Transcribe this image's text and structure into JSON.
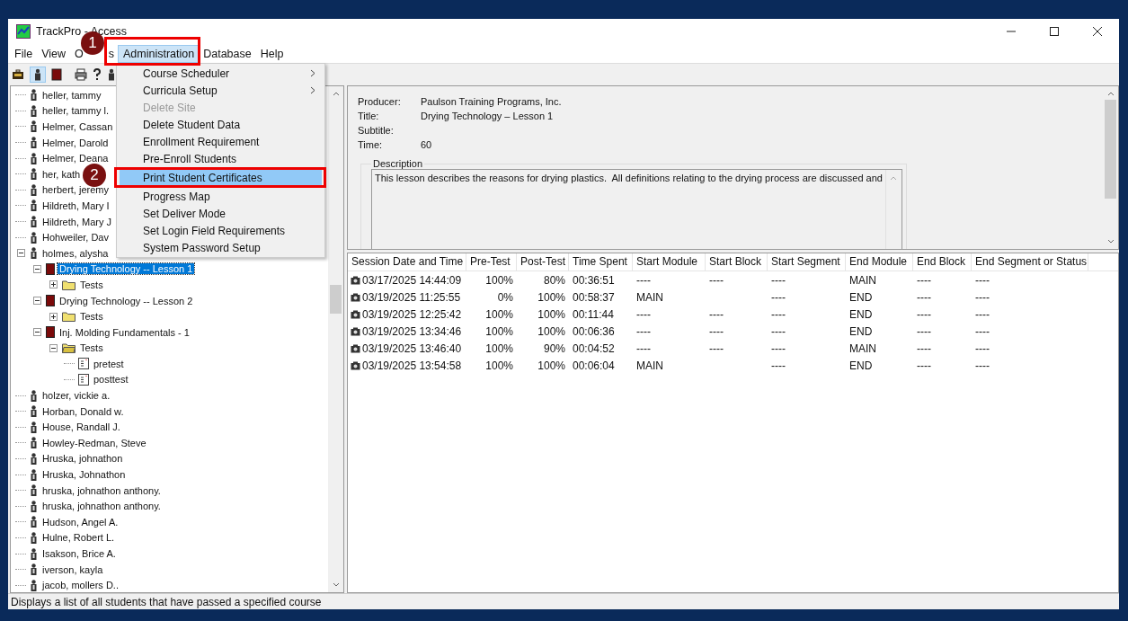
{
  "window": {
    "title": "TrackPro - Access"
  },
  "menu_bar": [
    {
      "label": "File",
      "selected": false
    },
    {
      "label": "View",
      "selected": false
    },
    {
      "label": "O",
      "tail": "s",
      "selected": false
    },
    {
      "label": "Administration",
      "selected": true
    },
    {
      "label": "Database",
      "selected": false
    },
    {
      "label": "Help",
      "selected": false
    }
  ],
  "admin_menu": [
    {
      "label": "Course Scheduler",
      "submenu": true,
      "disabled": false,
      "selected": false
    },
    {
      "label": "Curricula Setup",
      "submenu": true,
      "disabled": false,
      "selected": false
    },
    {
      "label": "Delete Site",
      "submenu": false,
      "disabled": true,
      "selected": false
    },
    {
      "label": "Delete Student Data",
      "submenu": false,
      "disabled": false,
      "selected": false
    },
    {
      "label": "Enrollment Requirement",
      "submenu": false,
      "disabled": false,
      "selected": false
    },
    {
      "label": "Pre-Enroll Students",
      "submenu": false,
      "disabled": false,
      "selected": false
    },
    {
      "label": "Print Student Certificates",
      "submenu": false,
      "disabled": false,
      "selected": true
    },
    {
      "label": "Progress Map",
      "submenu": false,
      "disabled": false,
      "selected": false
    },
    {
      "label": "Set Deliver Mode",
      "submenu": false,
      "disabled": false,
      "selected": false
    },
    {
      "label": "Set Login Field Requirements",
      "submenu": false,
      "disabled": false,
      "selected": false
    },
    {
      "label": "System Password Setup",
      "submenu": false,
      "disabled": false,
      "selected": false
    }
  ],
  "callouts": [
    {
      "number": "1"
    },
    {
      "number": "2"
    }
  ],
  "tree": [
    {
      "label": "heller, tammy",
      "kind": "student",
      "selected": false
    },
    {
      "label": "heller, tammy l.",
      "kind": "student",
      "selected": false
    },
    {
      "label": "Helmer, Cassan",
      "kind": "student",
      "selected": false
    },
    {
      "label": "Helmer, Darold",
      "kind": "student",
      "selected": false
    },
    {
      "label": "Helmer, Deana",
      "kind": "student",
      "selected": false
    },
    {
      "label": "her, kath",
      "kind": "student",
      "selected": false
    },
    {
      "label": "herbert, jeremy",
      "kind": "student",
      "selected": false
    },
    {
      "label": "Hildreth, Mary I",
      "kind": "student",
      "selected": false
    },
    {
      "label": "Hildreth, Mary J",
      "kind": "student",
      "selected": false
    },
    {
      "label": "Hohweiler, Dav",
      "kind": "student",
      "selected": false
    },
    {
      "label": "holmes, alysha",
      "kind": "student",
      "selected": false,
      "expanded": true,
      "children": [
        {
          "label": "Drying Technology -- Lesson 1",
          "kind": "course",
          "selected": true,
          "expanded": true,
          "children": [
            {
              "label": "Tests",
              "kind": "folder",
              "selected": false,
              "expanded": false
            }
          ]
        },
        {
          "label": "Drying Technology -- Lesson 2",
          "kind": "course",
          "selected": false,
          "expanded": true,
          "children": [
            {
              "label": "Tests",
              "kind": "folder",
              "selected": false,
              "expanded": false
            }
          ]
        },
        {
          "label": "Inj. Molding Fundamentals - 1",
          "kind": "course",
          "selected": false,
          "expanded": true,
          "children": [
            {
              "label": "Tests",
              "kind": "folder",
              "selected": false,
              "expanded": true,
              "children": [
                {
                  "label": "pretest",
                  "kind": "test",
                  "selected": false
                },
                {
                  "label": "posttest",
                  "kind": "test",
                  "selected": false
                }
              ]
            }
          ]
        }
      ]
    },
    {
      "label": "holzer, vickie a.",
      "kind": "student",
      "selected": false
    },
    {
      "label": "Horban, Donald w.",
      "kind": "student",
      "selected": false
    },
    {
      "label": "House, Randall J.",
      "kind": "student",
      "selected": false
    },
    {
      "label": "Howley-Redman, Steve",
      "kind": "student",
      "selected": false
    },
    {
      "label": "Hruska, johnathon",
      "kind": "student",
      "selected": false
    },
    {
      "label": "Hruska, Johnathon",
      "kind": "student",
      "selected": false
    },
    {
      "label": "hruska, johnathon anthony.",
      "kind": "student",
      "selected": false
    },
    {
      "label": "hruska, johnathon anthony.",
      "kind": "student",
      "selected": false
    },
    {
      "label": "Hudson, Angel A.",
      "kind": "student",
      "selected": false
    },
    {
      "label": "Hulne, Robert L.",
      "kind": "student",
      "selected": false
    },
    {
      "label": "Isakson, Brice A.",
      "kind": "student",
      "selected": false
    },
    {
      "label": "iverson, kayla",
      "kind": "student",
      "selected": false
    },
    {
      "label": "jacob, mollers D..",
      "kind": "student",
      "selected": false
    }
  ],
  "details": {
    "fields": [
      {
        "label": "Producer:",
        "value": "Paulson Training Programs, Inc."
      },
      {
        "label": "Title:",
        "value": "Drying Technology – Lesson 1"
      },
      {
        "label": "Subtitle:"
      },
      {
        "label": "Time:",
        "value": "60"
      }
    ],
    "description_label": "Description",
    "description": "This lesson describes the reasons for drying plastics.  All definitions relating to the drying process are discussed and"
  },
  "sessions": {
    "columns": [
      "Session Date and Time",
      "Pre-Test",
      "Post-Test",
      "Time Spent",
      "Start Module",
      "Start Block",
      "Start Segment",
      "End Module",
      "End Block",
      "End Segment or Status"
    ],
    "rows": [
      [
        "03/17/2025 14:44:09",
        "100%",
        "80%",
        "00:36:51",
        "----",
        "----",
        "----",
        "MAIN",
        "----",
        "----"
      ],
      [
        "03/19/2025 11:25:55",
        "0%",
        "100%",
        "00:58:37",
        "MAIN",
        null,
        "----",
        "END",
        "----",
        "----"
      ],
      [
        "03/19/2025 12:25:42",
        "100%",
        "100%",
        "00:11:44",
        "----",
        "----",
        "----",
        "END",
        "----",
        "----"
      ],
      [
        "03/19/2025 13:34:46",
        "100%",
        "100%",
        "00:06:36",
        "----",
        "----",
        "----",
        "END",
        "----",
        "----"
      ],
      [
        "03/19/2025 13:46:40",
        "100%",
        "90%",
        "00:04:52",
        "----",
        "----",
        "----",
        "MAIN",
        "----",
        "----"
      ],
      [
        "03/19/2025 13:54:58",
        "100%",
        "100%",
        "00:06:04",
        "MAIN",
        null,
        "----",
        "END",
        "----",
        "----"
      ]
    ]
  },
  "status_bar": {
    "text": "Displays a list of all students that have passed a specified course"
  }
}
